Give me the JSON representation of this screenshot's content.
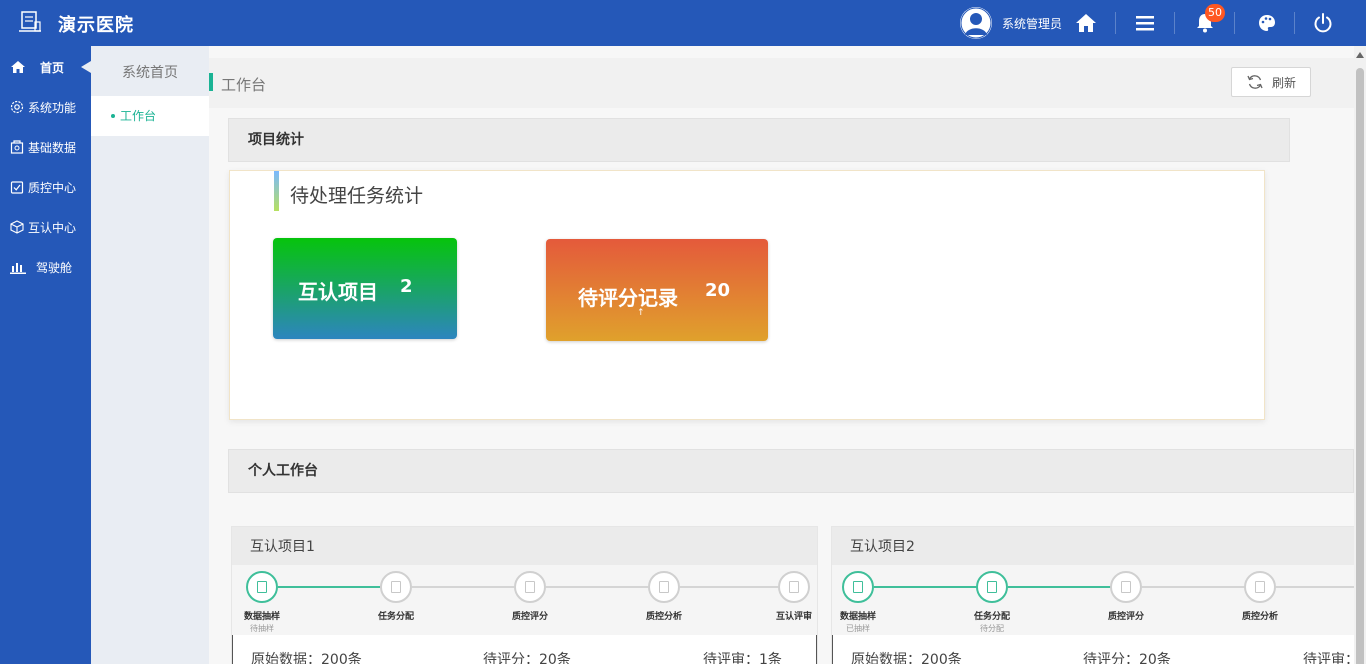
{
  "app": {
    "title": "演示医院"
  },
  "header": {
    "user_name": "系统管理员",
    "notification_count": "50",
    "icons": [
      "home-icon",
      "menu-icon",
      "bell-icon",
      "palette-icon",
      "power-icon"
    ]
  },
  "nav": {
    "items": [
      {
        "label": "首页",
        "icon": "home-icon"
      },
      {
        "label": "系统功能",
        "icon": "gear-icon"
      },
      {
        "label": "基础数据",
        "icon": "data-icon"
      },
      {
        "label": "质控中心",
        "icon": "check-icon"
      },
      {
        "label": "互认中心",
        "icon": "cube-icon"
      },
      {
        "label": "驾驶舱",
        "icon": "chart-icon"
      }
    ]
  },
  "subnav": {
    "title": "系统首页",
    "item": "工作台"
  },
  "main": {
    "breadcrumb": "工作台",
    "refresh_label": "刷新",
    "project_stats_title": "项目统计",
    "pending_title": "待处理任务统计",
    "card1": {
      "label": "互认项目",
      "count": "2"
    },
    "card2": {
      "label": "待评分记录",
      "count": "20",
      "note": "↑"
    },
    "personal_title": "个人工作台"
  },
  "projects": [
    {
      "title": "互认项目1",
      "steps": [
        {
          "label": "数据抽样",
          "sub": "待抽样"
        },
        {
          "label": "任务分配",
          "sub": ""
        },
        {
          "label": "质控评分",
          "sub": ""
        },
        {
          "label": "质控分析",
          "sub": ""
        },
        {
          "label": "互认评审",
          "sub": ""
        }
      ],
      "stats": [
        "原始数据：200条",
        "待评分：20条",
        "待评审：1条"
      ]
    },
    {
      "title": "互认项目2",
      "steps": [
        {
          "label": "数据抽样",
          "sub": "已抽样"
        },
        {
          "label": "任务分配",
          "sub": "待分配"
        },
        {
          "label": "质控评分",
          "sub": ""
        },
        {
          "label": "质控分析",
          "sub": ""
        }
      ],
      "stats": [
        "原始数据：200条",
        "待评分：20条",
        "待评审："
      ]
    }
  ],
  "colors": {
    "primary": "#2558b8",
    "accent": "#1bb394",
    "badge": "#ff5722"
  }
}
